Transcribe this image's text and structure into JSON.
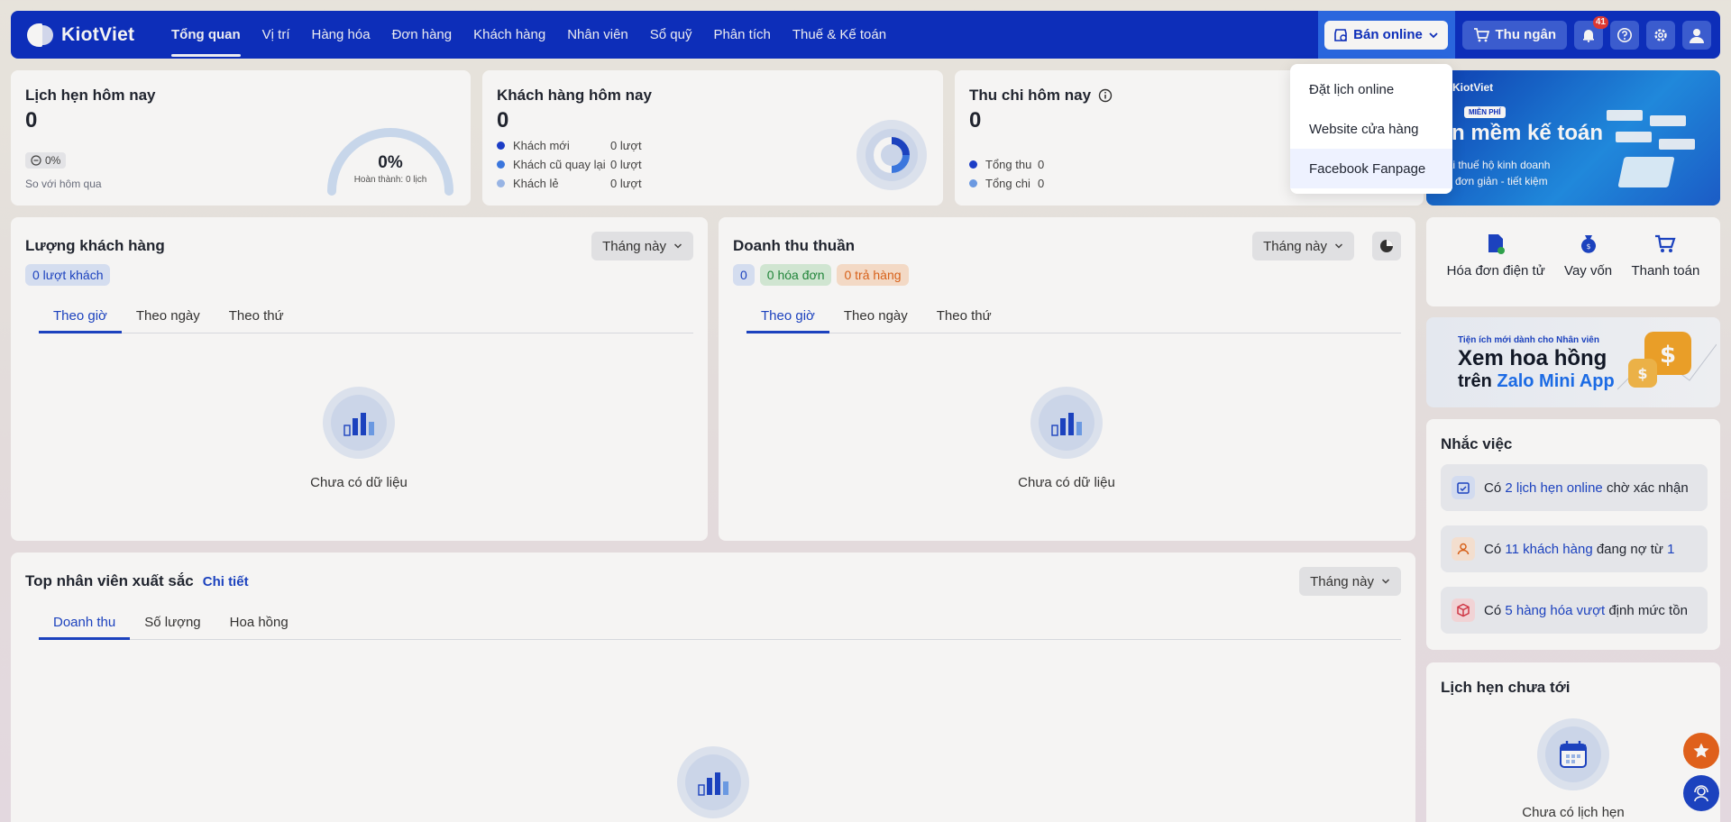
{
  "brand": {
    "name": "KiotViet"
  },
  "nav": {
    "items": [
      "Tổng quan",
      "Vị trí",
      "Hàng hóa",
      "Đơn hàng",
      "Khách hàng",
      "Nhân viên",
      "Sổ quỹ",
      "Phân tích",
      "Thuế & Kế toán"
    ],
    "active": "Tổng quan"
  },
  "header": {
    "online_label": "Bán online",
    "cashier_label": "Thu ngân",
    "notifications_count": "41"
  },
  "online_menu": {
    "items": [
      "Đặt lịch online",
      "Website cửa hàng",
      "Facebook Fanpage"
    ],
    "hovered": "Facebook Fanpage"
  },
  "appointments_today": {
    "title": "Lịch hẹn hôm nay",
    "value": "0",
    "change": "0%",
    "compare_label": "So với hôm qua",
    "gauge_percent": "0%",
    "gauge_sub": "Hoàn thành: 0 lịch"
  },
  "customers_today": {
    "title": "Khách hàng hôm nay",
    "value": "0",
    "rows": [
      {
        "label": "Khách mới",
        "value": "0 lượt",
        "color": "#1b3fd0"
      },
      {
        "label": "Khách cũ quay lại",
        "value": "0 lượt",
        "color": "#3b7be8"
      },
      {
        "label": "Khách lẻ",
        "value": "0 lượt",
        "color": "#9dbcf0"
      }
    ]
  },
  "cashflow_today": {
    "title": "Thu chi hôm nay",
    "value": "0",
    "rows": [
      {
        "label": "Tổng thu",
        "value": "0",
        "color": "#1b3fd0"
      },
      {
        "label": "Tổng chi",
        "value": "0",
        "color": "#6ea0ec"
      }
    ]
  },
  "customer_volume": {
    "title": "Lượng khách hàng",
    "period": "Tháng này",
    "badge": "0 lượt khách",
    "tabs": [
      "Theo giờ",
      "Theo ngày",
      "Theo thứ"
    ],
    "active_tab": "Theo giờ",
    "empty_text": "Chưa có dữ liệu"
  },
  "net_revenue": {
    "title": "Doanh thu thuần",
    "period": "Tháng này",
    "tags": [
      "0",
      "0 hóa đơn",
      "0 trả hàng"
    ],
    "tabs": [
      "Theo giờ",
      "Theo ngày",
      "Theo thứ"
    ],
    "active_tab": "Theo giờ",
    "empty_text": "Chưa có dữ liệu"
  },
  "top_staff": {
    "title": "Top nhân viên xuất sắc",
    "detail_link": "Chi tiết",
    "period": "Tháng này",
    "tabs": [
      "Doanh thu",
      "Số lượng",
      "Hoa hồng"
    ],
    "active_tab": "Doanh thu"
  },
  "promo_banner": {
    "brand": "KiotViet",
    "tag": "MIỄN PHÍ",
    "headline": "hần mềm kế toán",
    "line1": "khai thuế hộ kinh doanh",
    "line2": "đơn giản - tiết kiệm"
  },
  "quick_actions": [
    "Hóa đơn điện tử",
    "Vay vốn",
    "Thanh toán"
  ],
  "zalo_banner": {
    "kicker": "Tiện ích mới dành cho Nhân viên",
    "headline": "Xem hoa hồng",
    "line2_prefix": "trên",
    "line2_highlight": "Zalo Mini App"
  },
  "reminders": {
    "title": "Nhắc việc",
    "items": [
      {
        "prefix": "Có",
        "link": "2 lịch hẹn online",
        "suffix": "chờ xác nhận",
        "link2": ""
      },
      {
        "prefix": "Có",
        "link": "11 khách hàng",
        "suffix": "đang nợ từ",
        "link2": "1"
      },
      {
        "prefix": "Có",
        "link": "5 hàng hóa vượt",
        "suffix": "định mức tồn",
        "link2": ""
      }
    ]
  },
  "upcoming": {
    "title": "Lịch hẹn chưa tới",
    "empty_text": "Chưa có lịch hẹn"
  },
  "colors": {
    "primary": "#0b2fc2",
    "link": "#1b44c8",
    "green_tag": "#1f8a3c",
    "orange_tag": "#e0651b",
    "fab_orange": "#e8641c"
  }
}
